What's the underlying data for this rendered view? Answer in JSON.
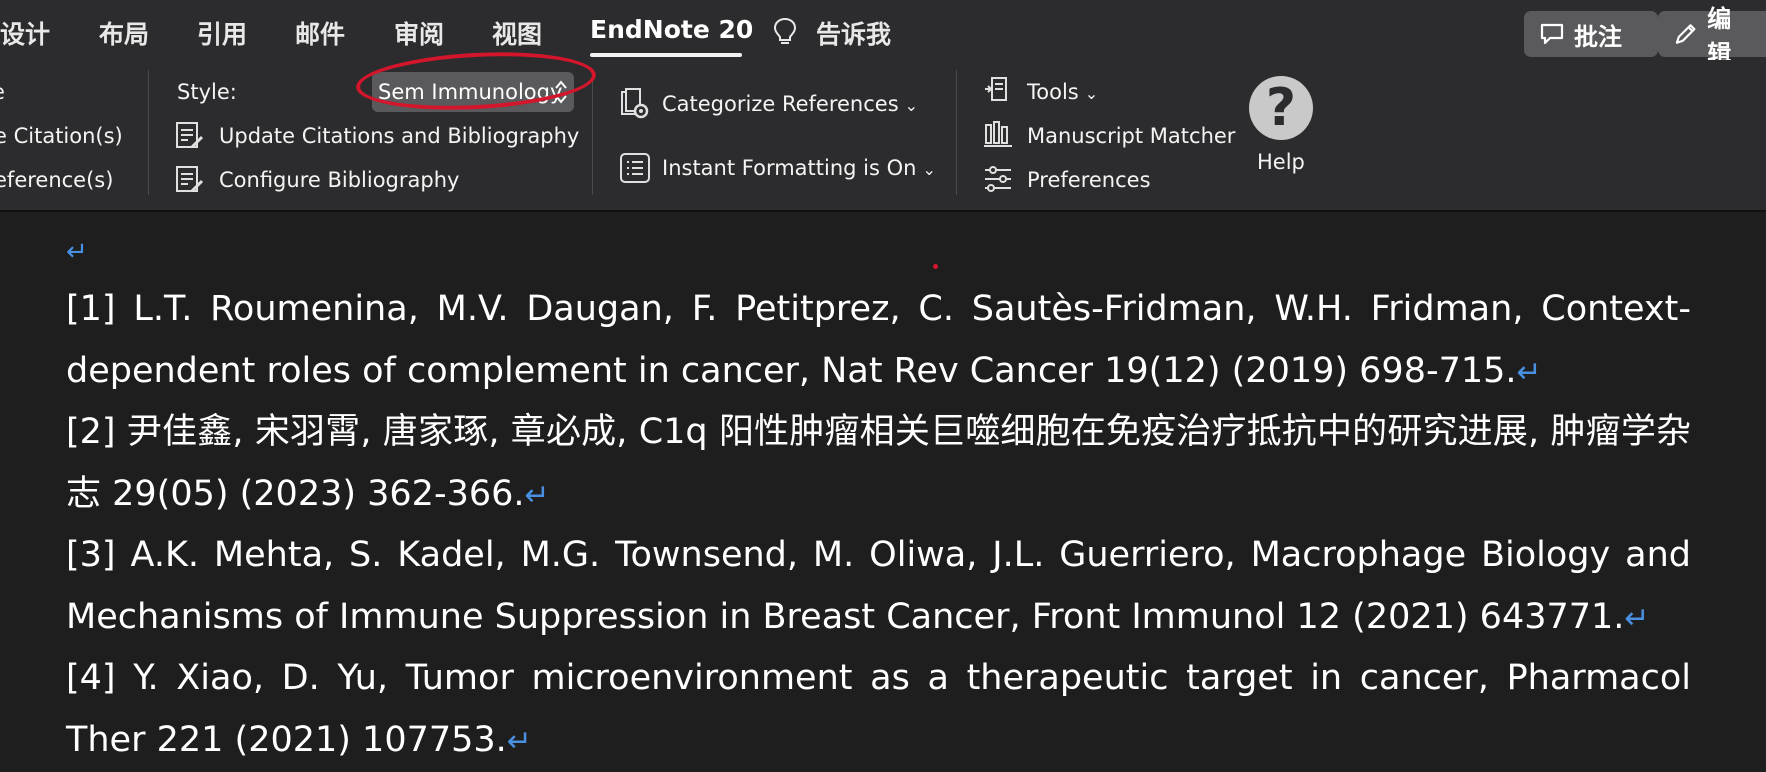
{
  "tabs": [
    {
      "label": "设计"
    },
    {
      "label": "布局"
    },
    {
      "label": "引用"
    },
    {
      "label": "邮件"
    },
    {
      "label": "审阅"
    },
    {
      "label": "视图"
    },
    {
      "label": "EndNote 20",
      "active": true
    },
    {
      "label": "告诉我"
    }
  ],
  "top_buttons": {
    "comment": "批注",
    "edit": "编辑"
  },
  "ribbon": {
    "left_partial": {
      "item1": "e",
      "item2": "e Citation(s)",
      "item3": "eference(s)"
    },
    "style_label": "Style:",
    "style_value": "Sem Immunology",
    "update_citations": "Update Citations and Bibliography",
    "configure_bibliography": "Configure Bibliography",
    "categorize_references": "Categorize References",
    "instant_formatting": "Instant Formatting is On",
    "tools": "Tools",
    "manuscript_matcher": "Manuscript Matcher",
    "preferences": "Preferences",
    "help": "Help"
  },
  "document": {
    "paragraph_mark": "↵",
    "references": [
      {
        "text": "[1] L.T. Roumenina, M.V. Daugan, F. Petitprez, C. Sautès-Fridman, W.H. Fridman, Context-dependent roles of complement in cancer, Nat Rev Cancer 19(12) (2019) 698-715."
      },
      {
        "text": "[2] 尹佳鑫, 宋羽霄, 唐家琢, 章必成, C1q 阳性肿瘤相关巨噬细胞在免疫治疗抵抗中的研究进展, 肿瘤学杂志 29(05) (2023) 362-366."
      },
      {
        "text": "[3] A.K. Mehta, S. Kadel, M.G. Townsend, M. Oliwa, J.L. Guerriero, Macrophage Biology and Mechanisms of Immune Suppression in Breast Cancer, Front Immunol 12 (2021) 643771."
      },
      {
        "text": "[4] Y. Xiao, D. Yu, Tumor microenvironment as a therapeutic target in cancer, Pharmacol Ther 221 (2021) 107753."
      }
    ]
  },
  "colors": {
    "background": "#1e1e1e",
    "ribbon": "#2c2c2e",
    "paragraph_mark": "#4a90e2",
    "annotation": "#d4162c"
  }
}
